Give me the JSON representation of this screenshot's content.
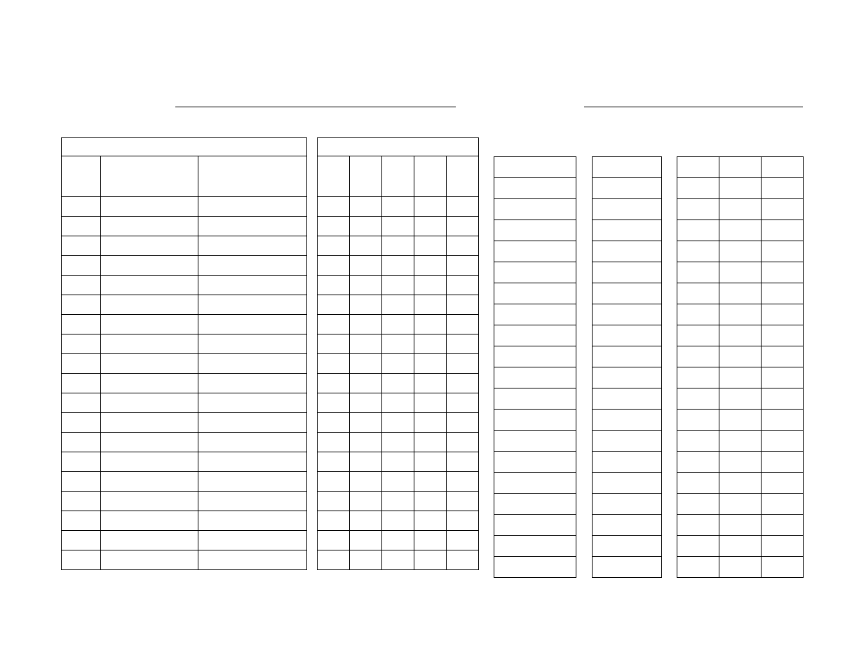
{
  "header": {
    "field1": "",
    "field2": ""
  },
  "tables": {
    "t1": {
      "title": "",
      "columns": [
        "",
        "",
        ""
      ],
      "rows": 19
    },
    "t2": {
      "title": "",
      "columns": [
        "",
        "",
        "",
        "",
        ""
      ],
      "rows": 19
    },
    "t3": {
      "columns": [
        ""
      ],
      "rows": 20
    },
    "t4": {
      "columns": [
        ""
      ],
      "rows": 20
    },
    "t5": {
      "columns": [
        "",
        "",
        ""
      ],
      "rows": 20
    }
  }
}
